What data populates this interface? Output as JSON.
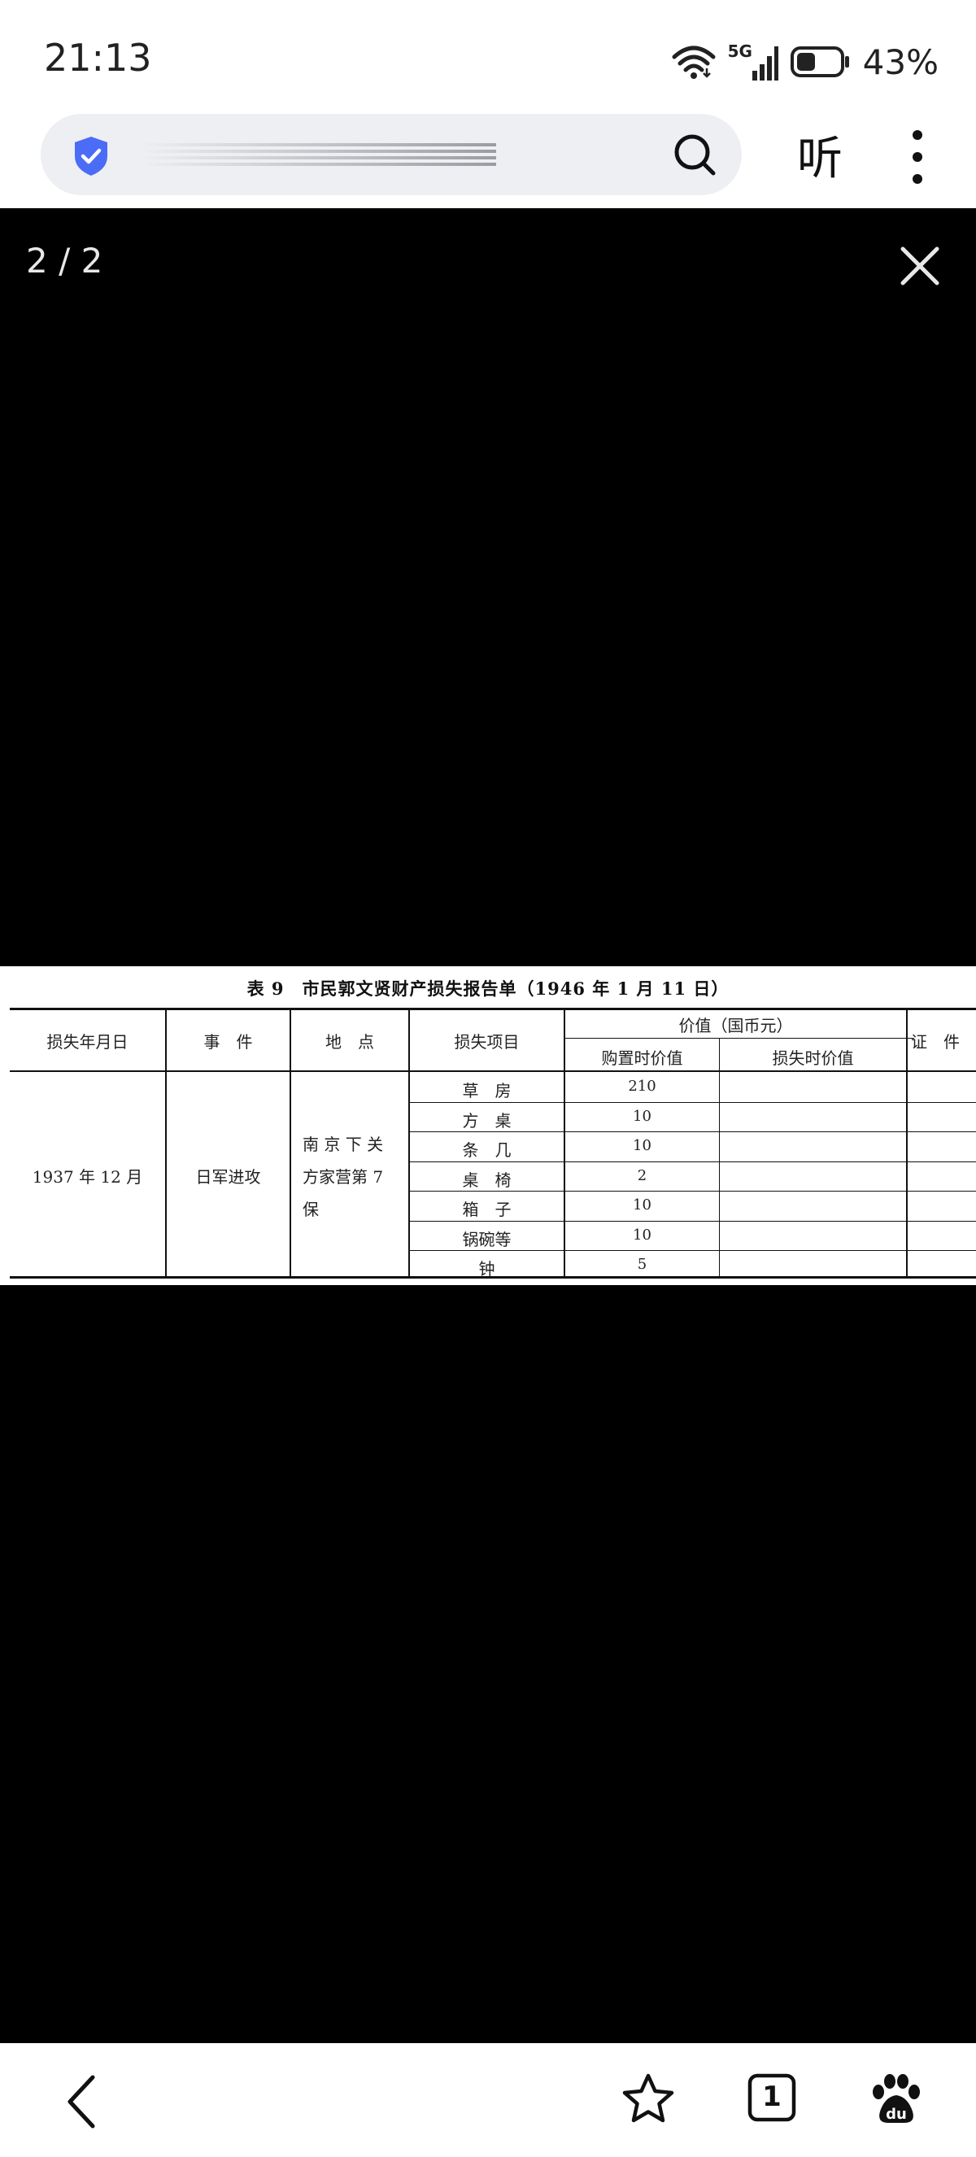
{
  "status_bar": {
    "time": "21:13",
    "network": "5G",
    "battery_percent": "43%",
    "battery_level": 0.43
  },
  "browser": {
    "secure_icon": "shield-check-icon",
    "search_icon": "search-icon",
    "listen_label": "听",
    "more_icon": "more-vertical-icon"
  },
  "viewer": {
    "page_counter": "2 / 2",
    "close_icon": "close-icon"
  },
  "document": {
    "title": "表 9　市民郭文贤财产损失报告单（1946 年 1 月 11 日）",
    "headers": {
      "date": "损失年月日",
      "event": "事　件",
      "place": "地　点",
      "item": "损失项目",
      "value": "价值（国币元）",
      "purchase_value": "购置时价值",
      "loss_value": "损失时价值",
      "evidence": "证　件"
    },
    "date": "1937 年 12 月",
    "event": "日军进攻",
    "place_lines": [
      "南 京 下 关",
      "方家营第 7",
      "保"
    ],
    "rows": [
      {
        "item": "草　房",
        "purchase_value": "210",
        "loss_value": ""
      },
      {
        "item": "方　桌",
        "purchase_value": "10",
        "loss_value": ""
      },
      {
        "item": "条　几",
        "purchase_value": "10",
        "loss_value": ""
      },
      {
        "item": "桌　椅",
        "purchase_value": "2",
        "loss_value": ""
      },
      {
        "item": "箱　子",
        "purchase_value": "10",
        "loss_value": ""
      },
      {
        "item": "锅碗等",
        "purchase_value": "10",
        "loss_value": ""
      },
      {
        "item": "钟",
        "purchase_value": "5",
        "loss_value": ""
      }
    ]
  },
  "bottom_nav": {
    "items": [
      "back-icon",
      "favorite-star-icon",
      "tabs-icon",
      "baidu-paw-icon"
    ],
    "tab_count": "1"
  }
}
